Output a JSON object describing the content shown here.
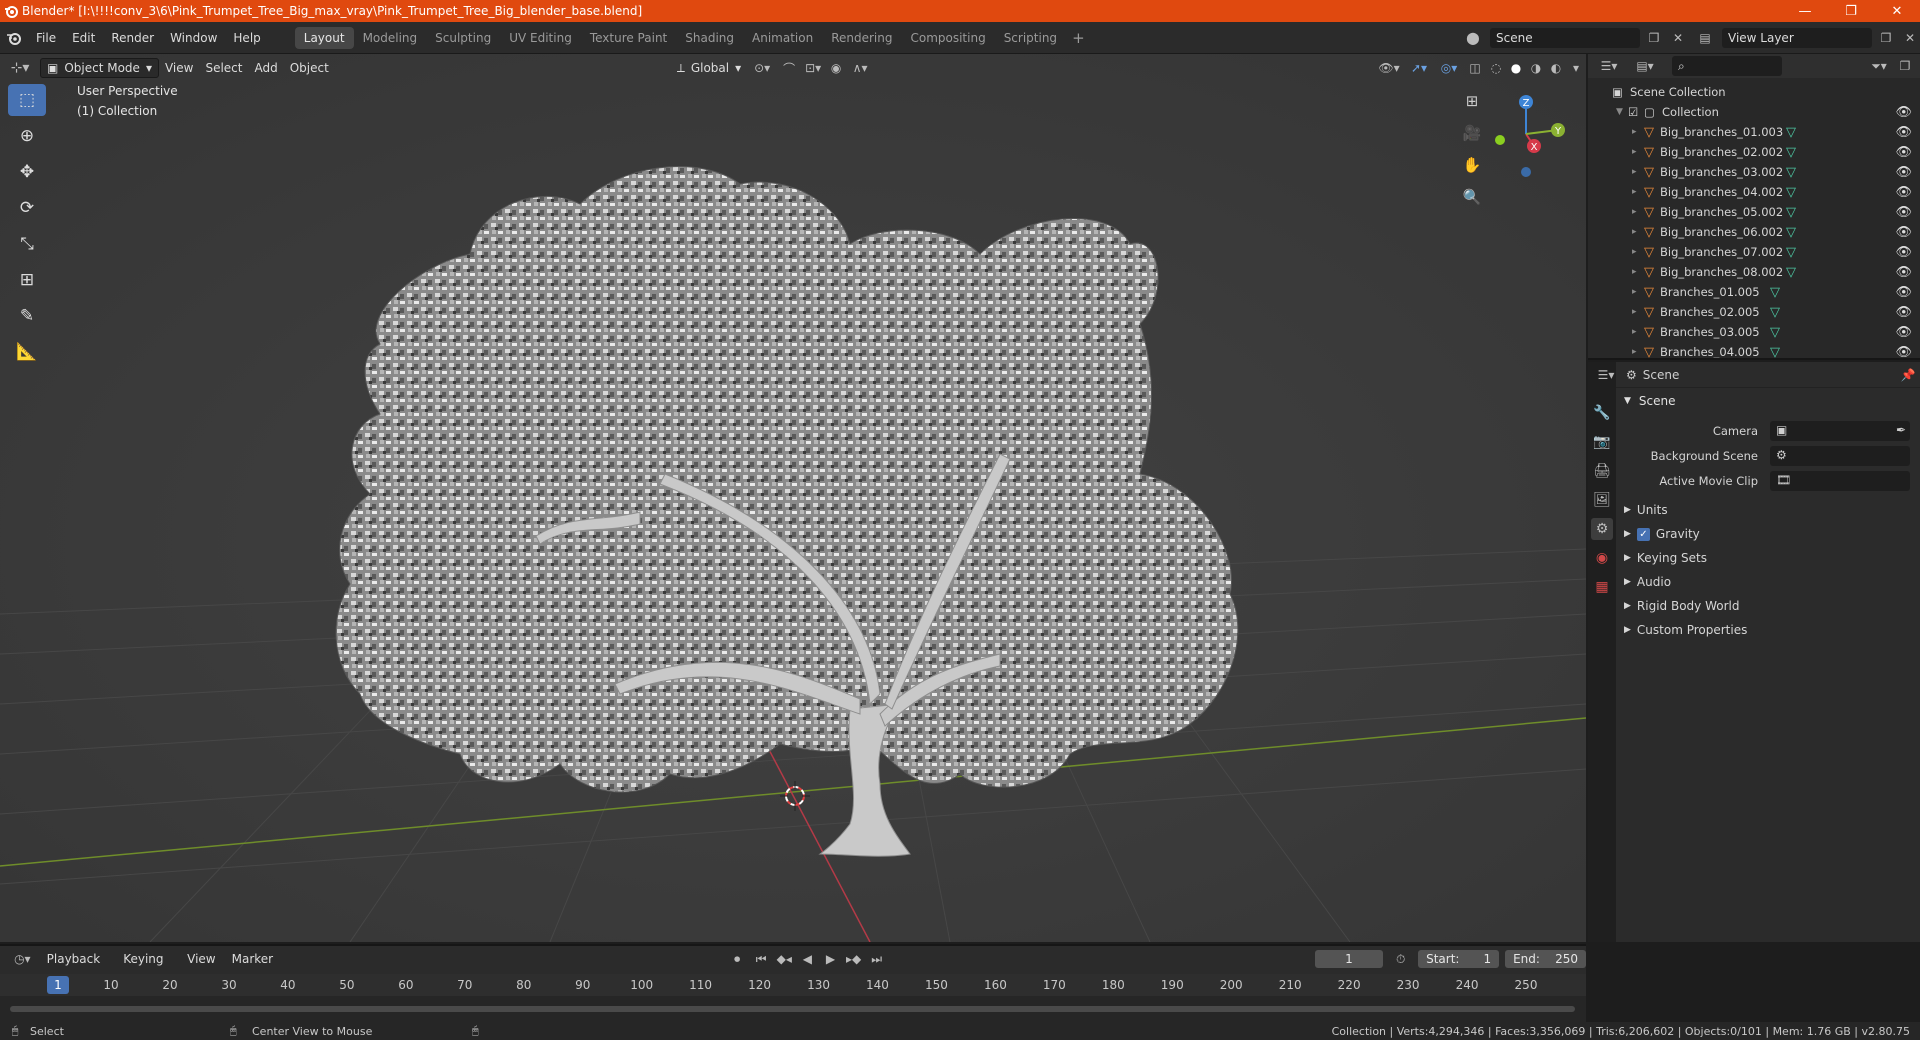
{
  "window": {
    "title": "Blender* [I:\\!!!!conv_3\\6\\Pink_Trumpet_Tree_Big_max_vray\\Pink_Trumpet_Tree_Big_blender_base.blend]",
    "minimize": "—",
    "maximize": "❐",
    "close": "✕"
  },
  "menu": [
    "File",
    "Edit",
    "Render",
    "Window",
    "Help"
  ],
  "workspaces": [
    "Layout",
    "Modeling",
    "Sculpting",
    "UV Editing",
    "Texture Paint",
    "Shading",
    "Animation",
    "Rendering",
    "Compositing",
    "Scripting"
  ],
  "workspace_add": "+",
  "top_right": {
    "scene": "Scene",
    "view_layer": "View Layer"
  },
  "viewport": {
    "mode": "Object Mode",
    "menus": [
      "View",
      "Select",
      "Add",
      "Object"
    ],
    "transform_orientation": "Global",
    "perspective_label": "User Perspective",
    "collection_label": "(1) Collection",
    "gizmo": {
      "z": "Z",
      "x": "X",
      "y": "Y"
    }
  },
  "outliner": {
    "search_placeholder": "",
    "root": "Scene Collection",
    "collection": "Collection",
    "items": [
      "Big_branches_01.003",
      "Big_branches_02.002",
      "Big_branches_03.002",
      "Big_branches_04.002",
      "Big_branches_05.002",
      "Big_branches_06.002",
      "Big_branches_07.002",
      "Big_branches_08.002",
      "Branches_01.005",
      "Branches_02.005",
      "Branches_03.005",
      "Branches_04.005"
    ]
  },
  "properties": {
    "header": "Scene",
    "panel": "Scene",
    "fields": {
      "camera": "Camera",
      "background_scene": "Background Scene",
      "active_movie_clip": "Active Movie Clip"
    },
    "subpanels": {
      "units": "Units",
      "gravity": "Gravity",
      "keying_sets": "Keying Sets",
      "audio": "Audio",
      "rigid_body_world": "Rigid Body World",
      "custom_properties": "Custom Properties"
    }
  },
  "timeline": {
    "menus": [
      "Playback",
      "Keying",
      "View",
      "Marker"
    ],
    "current_frame": "1",
    "start_label": "Start:",
    "start": "1",
    "end_label": "End:",
    "end": "250",
    "playhead": "1",
    "ticks": [
      "10",
      "20",
      "30",
      "40",
      "50",
      "60",
      "70",
      "80",
      "90",
      "100",
      "110",
      "120",
      "130",
      "140",
      "150",
      "160",
      "170",
      "180",
      "190",
      "200",
      "210",
      "220",
      "230",
      "240",
      "250"
    ]
  },
  "statusbar": {
    "select": "Select",
    "center_view": "Center View to Mouse",
    "stats": "Collection | Verts:4,294,346 | Faces:3,356,069 | Tris:6,206,602 | Objects:0/101 | Mem: 1.76 GB | v2.80.75"
  },
  "colors": {
    "accent": "#4772b3",
    "titlebar": "#e0490f",
    "x_axis": "#d63a4a",
    "y_axis": "#8bb132",
    "z_axis": "#3e85d6"
  }
}
